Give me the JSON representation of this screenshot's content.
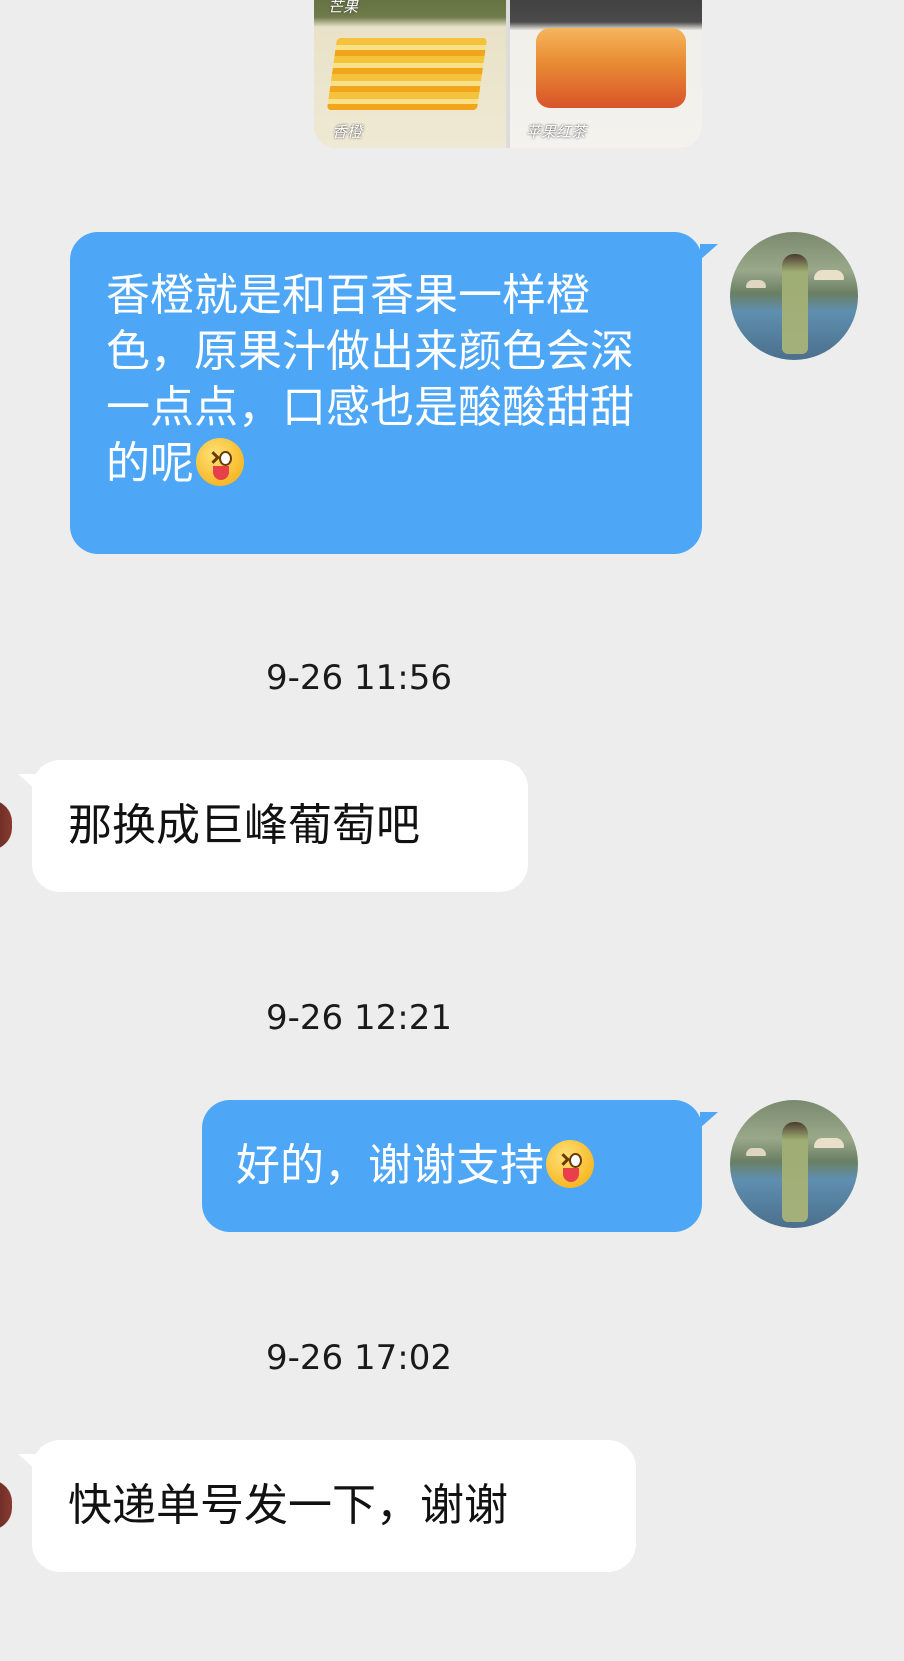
{
  "top_image": {
    "captions": [
      "芒果",
      "香橙",
      "苹果红茶"
    ]
  },
  "messages": [
    {
      "side": "mine",
      "text": "香橙就是和百香果一样橙色，原果汁做出来颜色会深一点点，口感也是酸酸甜甜的呢",
      "emoji": "tongue-wink-emoji"
    },
    {
      "side": "peer",
      "time": "9-26 11:56",
      "text": "那换成巨峰葡萄吧"
    },
    {
      "side": "mine",
      "time": "9-26 12:21",
      "text": "好的，谢谢支持",
      "emoji": "tongue-wink-emoji"
    },
    {
      "side": "peer",
      "time": "9-26 17:02",
      "text": "快递单号发一下，谢谢"
    }
  ],
  "colors": {
    "background": "#ededed",
    "mine_bubble": "#4da6f6",
    "peer_bubble": "#ffffff"
  }
}
